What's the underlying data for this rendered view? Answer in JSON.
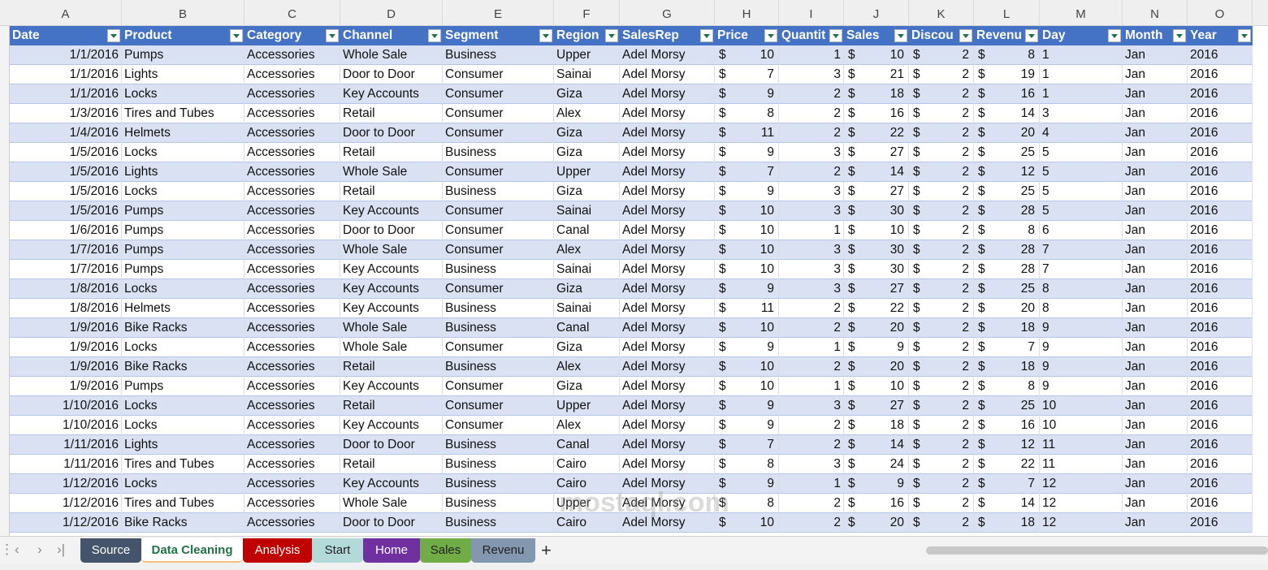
{
  "columns": [
    "A",
    "B",
    "C",
    "D",
    "E",
    "F",
    "G",
    "H",
    "I",
    "J",
    "K",
    "L",
    "M",
    "N",
    "O"
  ],
  "headers": [
    "Date",
    "Product",
    "Category",
    "Channel",
    "Segment",
    "Region",
    "SalesRep",
    "Price",
    "Quantit",
    "Sales",
    "Discou",
    "Revenu",
    "Day",
    "Month",
    "Year"
  ],
  "rows": [
    [
      "1/1/2016",
      "Pumps",
      "Accessories",
      "Whole Sale",
      "Business",
      "Upper",
      "Adel Morsy",
      "10",
      "1",
      "10",
      "2",
      "8",
      "1",
      "Jan",
      "2016"
    ],
    [
      "1/1/2016",
      "Lights",
      "Accessories",
      "Door to Door",
      "Consumer",
      "Sainai",
      "Adel Morsy",
      "7",
      "3",
      "21",
      "2",
      "19",
      "1",
      "Jan",
      "2016"
    ],
    [
      "1/1/2016",
      "Locks",
      "Accessories",
      "Key Accounts",
      "Consumer",
      "Giza",
      "Adel Morsy",
      "9",
      "2",
      "18",
      "2",
      "16",
      "1",
      "Jan",
      "2016"
    ],
    [
      "1/3/2016",
      "Tires and Tubes",
      "Accessories",
      "Retail",
      "Consumer",
      "Alex",
      "Adel Morsy",
      "8",
      "2",
      "16",
      "2",
      "14",
      "3",
      "Jan",
      "2016"
    ],
    [
      "1/4/2016",
      "Helmets",
      "Accessories",
      "Door to Door",
      "Consumer",
      "Giza",
      "Adel Morsy",
      "11",
      "2",
      "22",
      "2",
      "20",
      "4",
      "Jan",
      "2016"
    ],
    [
      "1/5/2016",
      "Locks",
      "Accessories",
      "Retail",
      "Business",
      "Giza",
      "Adel Morsy",
      "9",
      "3",
      "27",
      "2",
      "25",
      "5",
      "Jan",
      "2016"
    ],
    [
      "1/5/2016",
      "Lights",
      "Accessories",
      "Whole Sale",
      "Consumer",
      "Upper",
      "Adel Morsy",
      "7",
      "2",
      "14",
      "2",
      "12",
      "5",
      "Jan",
      "2016"
    ],
    [
      "1/5/2016",
      "Locks",
      "Accessories",
      "Retail",
      "Business",
      "Giza",
      "Adel Morsy",
      "9",
      "3",
      "27",
      "2",
      "25",
      "5",
      "Jan",
      "2016"
    ],
    [
      "1/5/2016",
      "Pumps",
      "Accessories",
      "Key Accounts",
      "Consumer",
      "Sainai",
      "Adel Morsy",
      "10",
      "3",
      "30",
      "2",
      "28",
      "5",
      "Jan",
      "2016"
    ],
    [
      "1/6/2016",
      "Pumps",
      "Accessories",
      "Door to Door",
      "Consumer",
      "Canal",
      "Adel Morsy",
      "10",
      "1",
      "10",
      "2",
      "8",
      "6",
      "Jan",
      "2016"
    ],
    [
      "1/7/2016",
      "Pumps",
      "Accessories",
      "Whole Sale",
      "Consumer",
      "Alex",
      "Adel Morsy",
      "10",
      "3",
      "30",
      "2",
      "28",
      "7",
      "Jan",
      "2016"
    ],
    [
      "1/7/2016",
      "Pumps",
      "Accessories",
      "Key Accounts",
      "Business",
      "Sainai",
      "Adel Morsy",
      "10",
      "3",
      "30",
      "2",
      "28",
      "7",
      "Jan",
      "2016"
    ],
    [
      "1/8/2016",
      "Locks",
      "Accessories",
      "Key Accounts",
      "Consumer",
      "Giza",
      "Adel Morsy",
      "9",
      "3",
      "27",
      "2",
      "25",
      "8",
      "Jan",
      "2016"
    ],
    [
      "1/8/2016",
      "Helmets",
      "Accessories",
      "Key Accounts",
      "Business",
      "Sainai",
      "Adel Morsy",
      "11",
      "2",
      "22",
      "2",
      "20",
      "8",
      "Jan",
      "2016"
    ],
    [
      "1/9/2016",
      "Bike Racks",
      "Accessories",
      "Whole Sale",
      "Business",
      "Canal",
      "Adel Morsy",
      "10",
      "2",
      "20",
      "2",
      "18",
      "9",
      "Jan",
      "2016"
    ],
    [
      "1/9/2016",
      "Locks",
      "Accessories",
      "Whole Sale",
      "Consumer",
      "Giza",
      "Adel Morsy",
      "9",
      "1",
      "9",
      "2",
      "7",
      "9",
      "Jan",
      "2016"
    ],
    [
      "1/9/2016",
      "Bike Racks",
      "Accessories",
      "Retail",
      "Business",
      "Alex",
      "Adel Morsy",
      "10",
      "2",
      "20",
      "2",
      "18",
      "9",
      "Jan",
      "2016"
    ],
    [
      "1/9/2016",
      "Pumps",
      "Accessories",
      "Key Accounts",
      "Consumer",
      "Giza",
      "Adel Morsy",
      "10",
      "1",
      "10",
      "2",
      "8",
      "9",
      "Jan",
      "2016"
    ],
    [
      "1/10/2016",
      "Locks",
      "Accessories",
      "Retail",
      "Consumer",
      "Upper",
      "Adel Morsy",
      "9",
      "3",
      "27",
      "2",
      "25",
      "10",
      "Jan",
      "2016"
    ],
    [
      "1/10/2016",
      "Locks",
      "Accessories",
      "Key Accounts",
      "Consumer",
      "Alex",
      "Adel Morsy",
      "9",
      "2",
      "18",
      "2",
      "16",
      "10",
      "Jan",
      "2016"
    ],
    [
      "1/11/2016",
      "Lights",
      "Accessories",
      "Door to Door",
      "Business",
      "Canal",
      "Adel Morsy",
      "7",
      "2",
      "14",
      "2",
      "12",
      "11",
      "Jan",
      "2016"
    ],
    [
      "1/11/2016",
      "Tires and Tubes",
      "Accessories",
      "Retail",
      "Business",
      "Cairo",
      "Adel Morsy",
      "8",
      "3",
      "24",
      "2",
      "22",
      "11",
      "Jan",
      "2016"
    ],
    [
      "1/12/2016",
      "Locks",
      "Accessories",
      "Key Accounts",
      "Business",
      "Cairo",
      "Adel Morsy",
      "9",
      "1",
      "9",
      "2",
      "7",
      "12",
      "Jan",
      "2016"
    ],
    [
      "1/12/2016",
      "Tires and Tubes",
      "Accessories",
      "Whole Sale",
      "Business",
      "Upper",
      "Adel Morsy",
      "8",
      "2",
      "16",
      "2",
      "14",
      "12",
      "Jan",
      "2016"
    ],
    [
      "1/12/2016",
      "Bike Racks",
      "Accessories",
      "Door to Door",
      "Business",
      "Cairo",
      "Adel Morsy",
      "10",
      "2",
      "20",
      "2",
      "18",
      "12",
      "Jan",
      "2016"
    ]
  ],
  "currency_symbol": "$",
  "sheet_tabs": [
    {
      "label": "Source",
      "color": "#44546a",
      "text": "#fff"
    },
    {
      "label": "Data Cleaning",
      "color": "#ffffff",
      "text": "#217346",
      "active": true
    },
    {
      "label": "Analysis",
      "color": "#c00000",
      "text": "#fff"
    },
    {
      "label": "Start",
      "color": "#b4d9d9",
      "text": "#222"
    },
    {
      "label": "Home",
      "color": "#7030a0",
      "text": "#fff"
    },
    {
      "label": "Sales",
      "color": "#70ad47",
      "text": "#222"
    },
    {
      "label": "Revenu",
      "color": "#8497b0",
      "text": "#222"
    }
  ],
  "add_sheet": "+",
  "watermark": "mostaql.com",
  "colors": {
    "header": "#4472c4",
    "band": "#d9e1f2"
  }
}
